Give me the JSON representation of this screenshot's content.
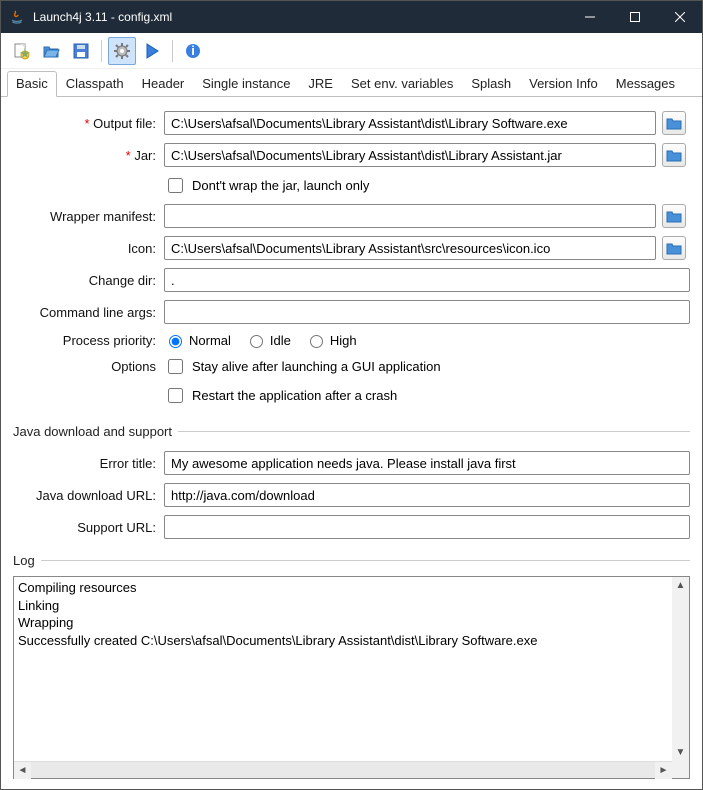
{
  "window": {
    "title": "Launch4j 3.11 - config.xml"
  },
  "toolbar": {
    "new": "new-file-icon",
    "open": "open-folder-icon",
    "save": "save-icon",
    "build": "gear-icon",
    "run": "play-icon",
    "about": "info-icon"
  },
  "tabs": [
    "Basic",
    "Classpath",
    "Header",
    "Single instance",
    "JRE",
    "Set env. variables",
    "Splash",
    "Version Info",
    "Messages"
  ],
  "active_tab": "Basic",
  "basic": {
    "labels": {
      "output_file": "Output file:",
      "jar": "Jar:",
      "dont_wrap": "Dont't wrap the jar, launch only",
      "wrapper_manifest": "Wrapper manifest:",
      "icon": "Icon:",
      "change_dir": "Change dir:",
      "cmd_args": "Command line args:",
      "process_priority": "Process priority:",
      "options": "Options",
      "stay_alive": "Stay alive after launching a GUI application",
      "restart": "Restart the application after a crash"
    },
    "values": {
      "output_file": "C:\\Users\\afsal\\Documents\\Library Assistant\\dist\\Library Software.exe",
      "jar": "C:\\Users\\afsal\\Documents\\Library Assistant\\dist\\Library Assistant.jar",
      "wrapper_manifest": "",
      "icon": "C:\\Users\\afsal\\Documents\\Library Assistant\\src\\resources\\icon.ico",
      "change_dir": ".",
      "cmd_args": ""
    },
    "priority": {
      "normal": "Normal",
      "idle": "Idle",
      "high": "High",
      "selected": "normal"
    },
    "options": {
      "stay_alive": false,
      "restart": false,
      "dont_wrap": false
    }
  },
  "java_section": {
    "legend": "Java download and support",
    "labels": {
      "error_title": "Error title:",
      "download_url": "Java download URL:",
      "support_url": "Support URL:"
    },
    "values": {
      "error_title": "My awesome application needs java. Please install java first",
      "download_url": "http://java.com/download",
      "support_url": ""
    }
  },
  "log": {
    "legend": "Log",
    "text": "Compiling resources\nLinking\nWrapping\nSuccessfully created C:\\Users\\afsal\\Documents\\Library Assistant\\dist\\Library Software.exe"
  }
}
